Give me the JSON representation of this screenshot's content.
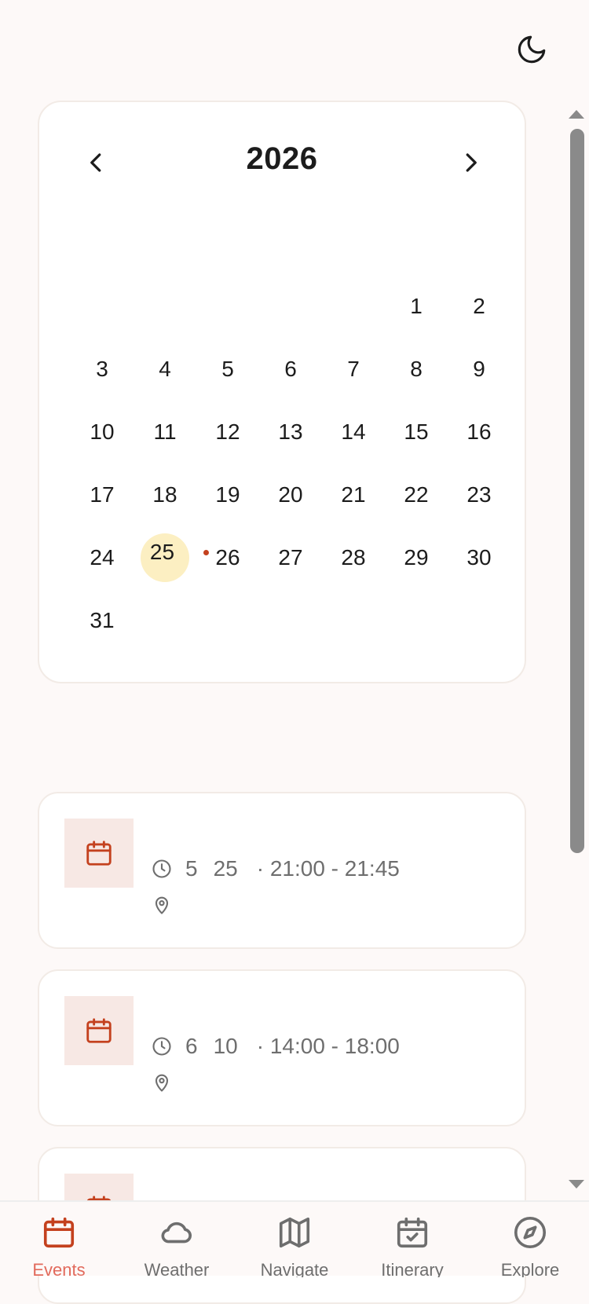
{
  "calendar": {
    "year": "2026",
    "leading_blanks": 5,
    "days": [
      "1",
      "2",
      "3",
      "4",
      "5",
      "6",
      "7",
      "8",
      "9",
      "10",
      "11",
      "12",
      "13",
      "14",
      "15",
      "16",
      "17",
      "18",
      "19",
      "20",
      "21",
      "22",
      "23",
      "24",
      "25",
      "26",
      "27",
      "28",
      "29",
      "30",
      "31"
    ],
    "selected_day": "25",
    "event_days": [
      "25"
    ]
  },
  "events": [
    {
      "month": "5",
      "date": "25",
      "time": "· 21:00 - 21:45"
    },
    {
      "month": "6",
      "date": "10",
      "time": "· 14:00 - 18:00"
    },
    {
      "month": "",
      "date": "",
      "time": ""
    }
  ],
  "bottom_nav": {
    "tabs": [
      {
        "label": "Events",
        "icon": "calendar-icon",
        "active": true
      },
      {
        "label": "Weather",
        "icon": "cloud-icon",
        "active": false
      },
      {
        "label": "Navigate",
        "icon": "map-icon",
        "active": false
      },
      {
        "label": "Itinerary",
        "icon": "calendar-check-icon",
        "active": false
      },
      {
        "label": "Explore",
        "icon": "compass-icon",
        "active": false
      }
    ]
  },
  "colors": {
    "accent": "#c4411e",
    "active_tab_label": "#e26a5c",
    "selected_day_bg": "#fcefc2",
    "page_bg": "#fdf9f8"
  }
}
